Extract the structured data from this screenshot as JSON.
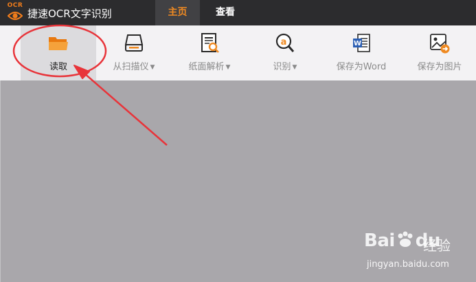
{
  "app": {
    "logo_text": "OCR",
    "title": "捷速OCR文字识别"
  },
  "tabs": [
    {
      "label": "主页",
      "active": true
    },
    {
      "label": "查看",
      "active": false
    }
  ],
  "ribbon": {
    "read": {
      "label": "读取",
      "icon": "folder-open-icon"
    },
    "scan": {
      "label": "从扫描仪",
      "icon": "scanner-icon",
      "has_dropdown": true
    },
    "parse": {
      "label": "纸面解析",
      "icon": "document-search-icon",
      "has_dropdown": true
    },
    "recognize": {
      "label": "识别",
      "icon": "ocr-recognize-icon",
      "has_dropdown": true
    },
    "save_word": {
      "label": "保存为Word",
      "icon": "word-document-icon"
    },
    "save_image": {
      "label": "保存为图片",
      "icon": "save-image-icon"
    }
  },
  "dropdown_arrow": "▼",
  "watermark": {
    "brand": "Bai",
    "brand_suffix": "du",
    "product": "经验",
    "url": "jingyan.baidu.com"
  },
  "colors": {
    "accent": "#ef8a22",
    "titlebar": "#2c2c2e",
    "ribbon": "#f3f2f4",
    "workspace": "#a9a7ab",
    "annotation": "#e8343a"
  }
}
